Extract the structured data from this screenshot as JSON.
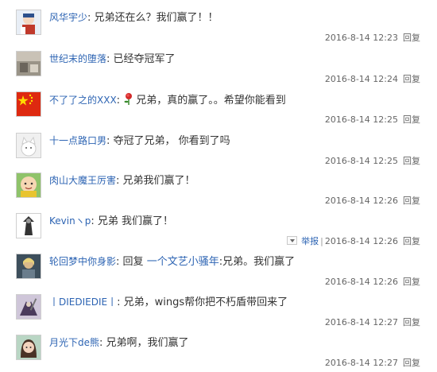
{
  "colors": {
    "link": "#2d64b3",
    "meta": "#666666",
    "text": "#333333"
  },
  "comments": [
    {
      "author": "风华宇少",
      "text": "兄弟还在么？我们赢了！！",
      "time": "2016-8-14 12:23",
      "reply": "回复",
      "avatar_icon": "cartoon-avatar-icon"
    },
    {
      "author": "世纪末的堕落",
      "text": "已经夺冠军了",
      "time": "2016-8-14 12:24",
      "reply": "回复",
      "avatar_icon": "room-photo-avatar-icon"
    },
    {
      "author": "不了了之的XXX",
      "text": "兄弟，真的赢了。。希望你能看到",
      "time": "2016-8-14 12:25",
      "reply": "回复",
      "avatar_icon": "china-flag-avatar-icon",
      "emoji": "rose-icon"
    },
    {
      "author": "十一点路口男",
      "text": "夺冠了兄弟， 你看到了吗",
      "time": "2016-8-14 12:25",
      "reply": "回复",
      "avatar_icon": "cat-avatar-icon"
    },
    {
      "author": "肉山大魔王厉害",
      "text": "兄弟我们赢了！",
      "time": "2016-8-14 12:26",
      "reply": "回复",
      "avatar_icon": "bald-kid-avatar-icon"
    },
    {
      "author": "Kevinヽp",
      "text": "兄弟 我们赢了！",
      "time": "2016-8-14 12:26",
      "report": "举报",
      "reply": "回复",
      "avatar_icon": "dark-figure-avatar-icon"
    },
    {
      "author": "轮回梦中你身影",
      "prefix": "回复",
      "reply_to": "一个文艺小骚年",
      "text": "兄弟。我们赢了",
      "time": "2016-8-14 12:26",
      "reply": "回复",
      "avatar_icon": "game-character-avatar-icon"
    },
    {
      "author": "丨DIEDIEDIE丨",
      "text": "兄弟，wings帮你把不朽盾带回来了",
      "time": "2016-8-14 12:27",
      "reply": "回复",
      "avatar_icon": "warrior-avatar-icon"
    },
    {
      "author": "月光下de熊",
      "text": "兄弟啊，我们赢了",
      "time": "2016-8-14 12:27",
      "reply": "回复",
      "avatar_icon": "girl-avatar-icon"
    }
  ]
}
